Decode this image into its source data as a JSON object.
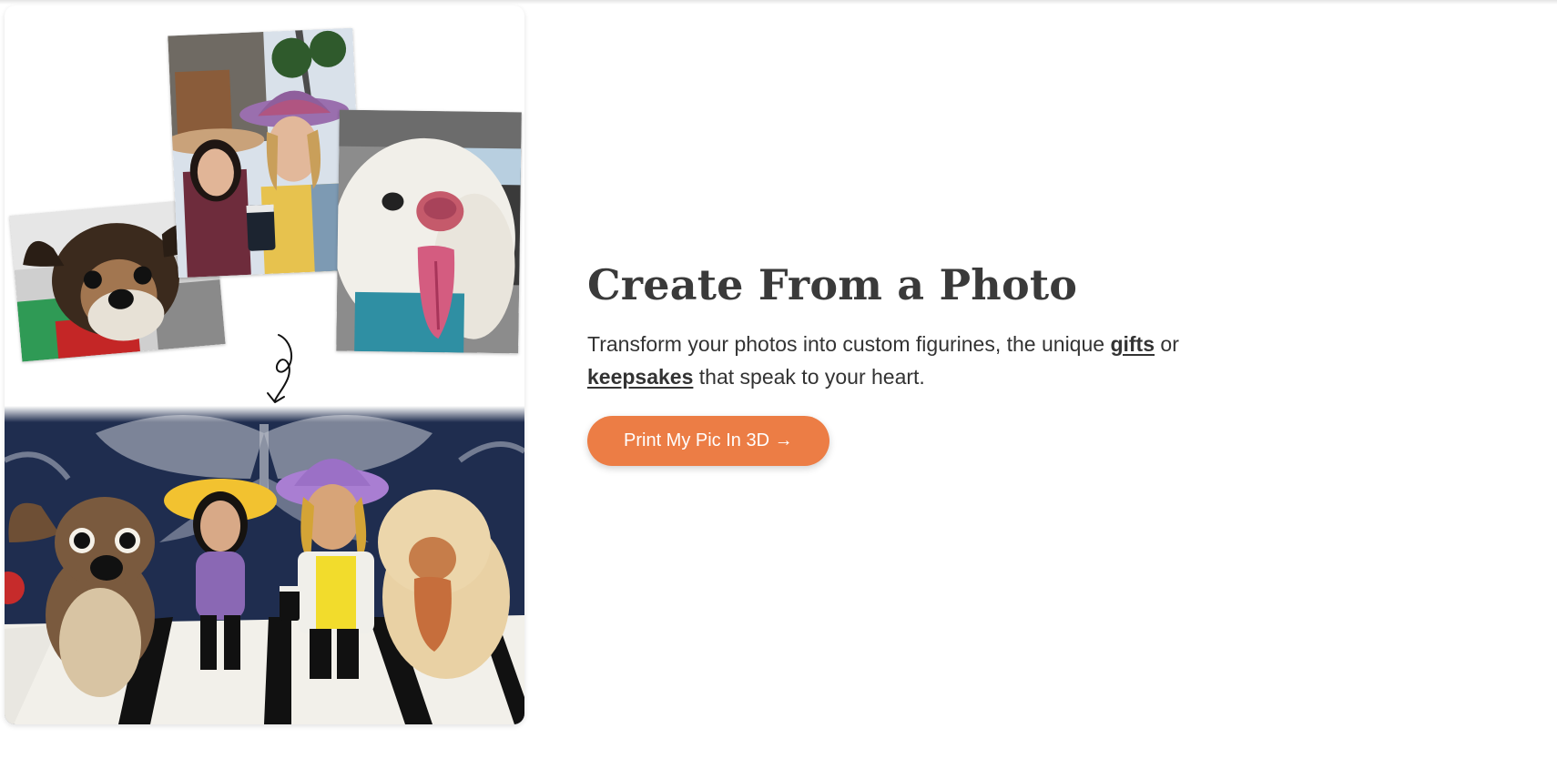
{
  "hero": {
    "heading": "Create From a Photo",
    "description_before_gifts": "Transform your photos into custom figurines, the unique ",
    "gifts_link": "gifts",
    "description_between": " or ",
    "keepsakes_link": "keepsakes",
    "description_after": " that speak to your heart.",
    "cta_label": "Print My Pic In 3D →"
  },
  "colors": {
    "accent": "#ec7d45",
    "heading": "#3a3a3a",
    "text": "#333333"
  }
}
